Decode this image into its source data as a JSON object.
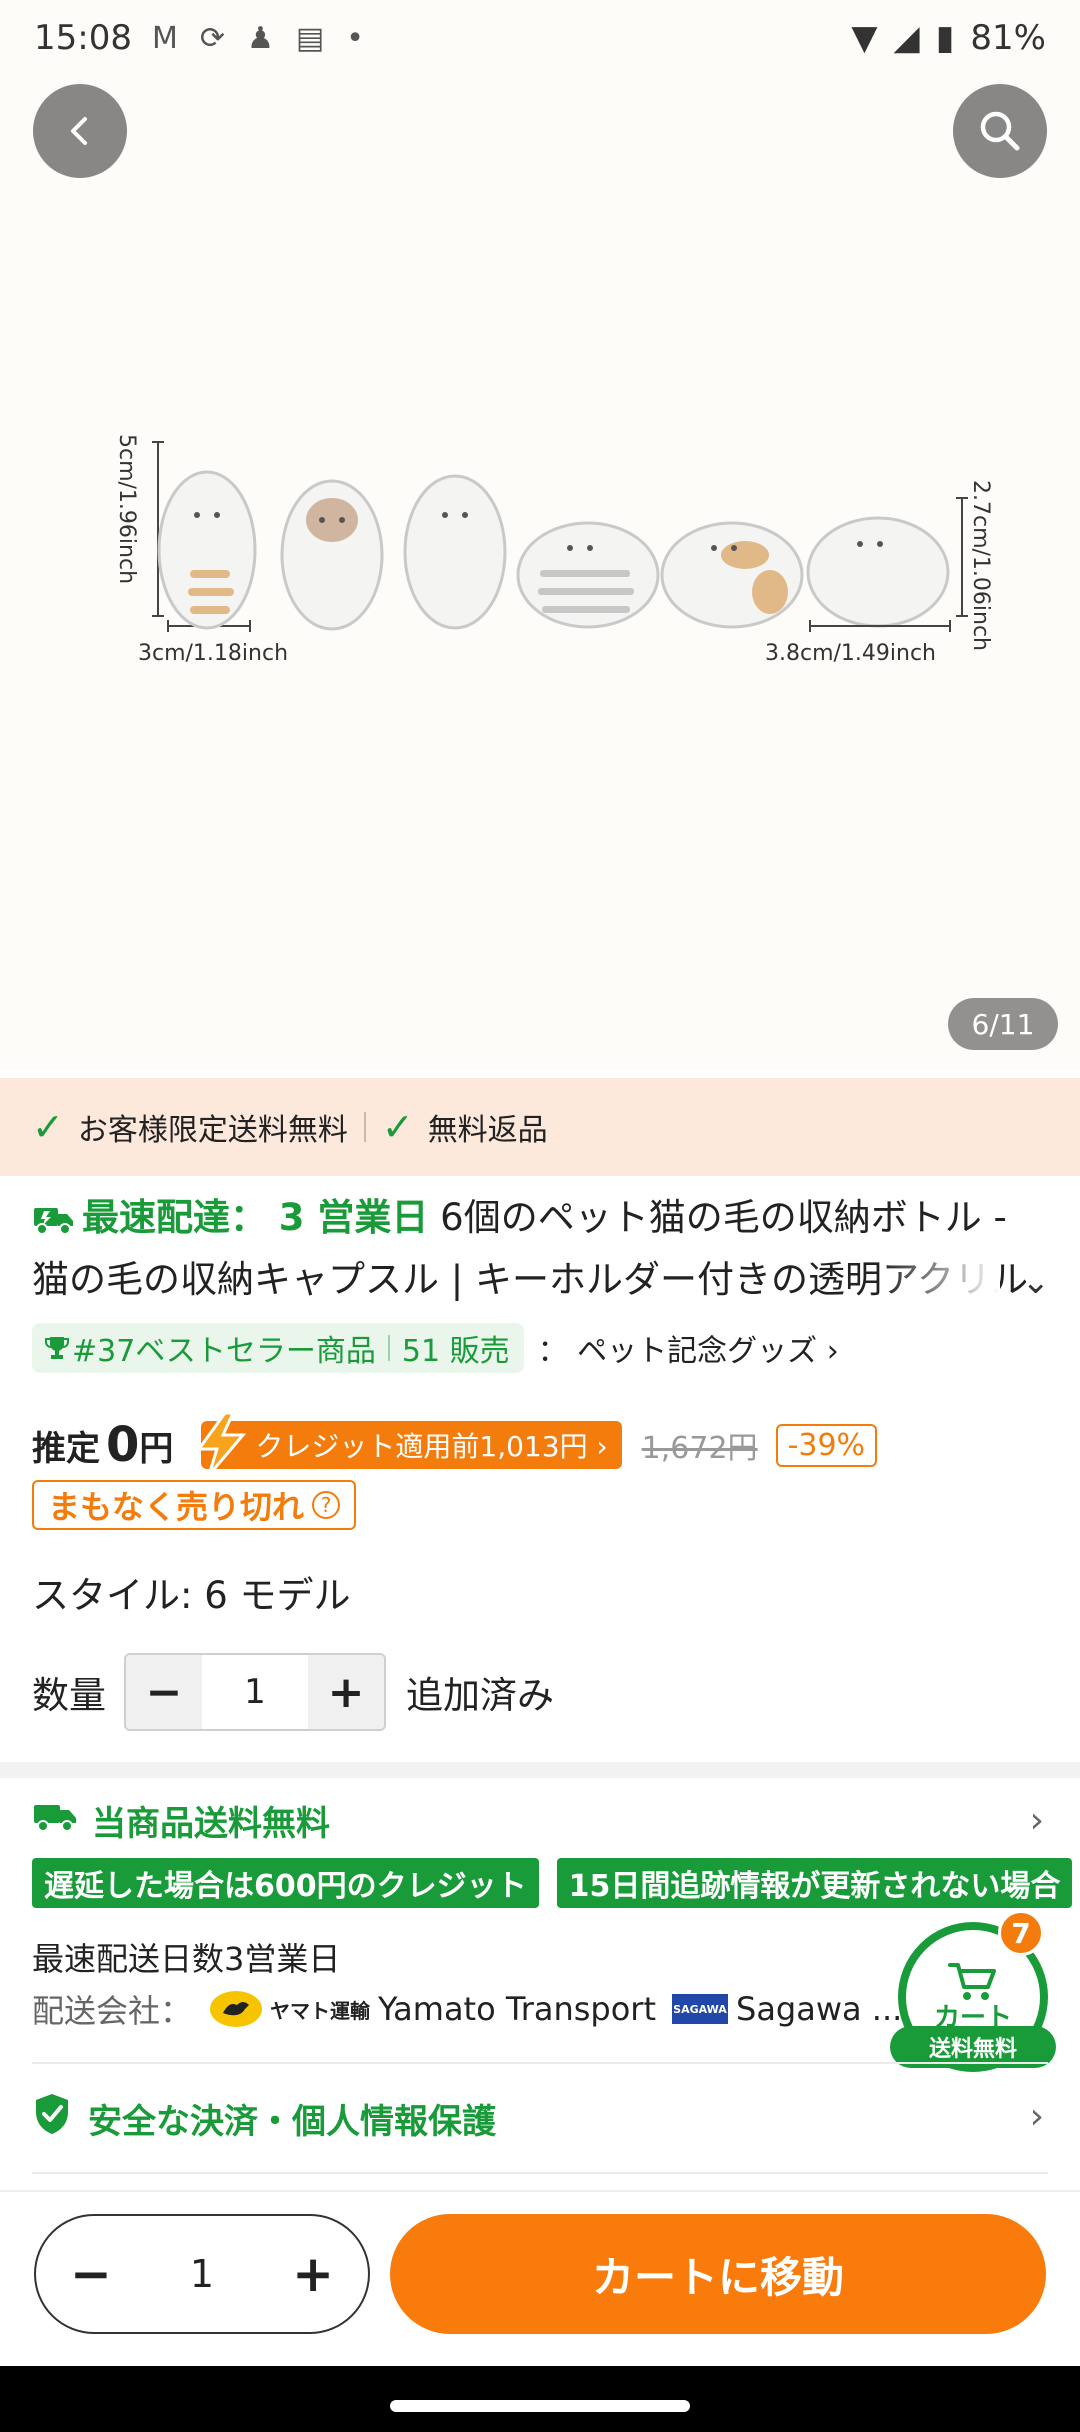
{
  "status_bar": {
    "time": "15:08",
    "battery": "81%",
    "icons": [
      "gmail-icon",
      "sync-icon",
      "keyhole-icon",
      "calendar-icon",
      "dot-icon"
    ]
  },
  "gallery": {
    "page_indicator": "6/11",
    "product_labels": {
      "height_left": "5cm/1.96inch",
      "width_left": "3cm/1.18inch",
      "height_right": "2.7cm/1.06inch",
      "width_right": "3.8cm/1.49inch"
    }
  },
  "promo": {
    "item1": "お客様限定送料無料",
    "item2": "無料返品"
  },
  "title": {
    "fast_label": "最速配達：",
    "fast_days": "3 営業日",
    "text": "6個のペット猫の毛の収納ボトル - 猫の毛の収納キャプスル | キーホルダー付きの透明アクリル"
  },
  "ranking": {
    "badge": "#37ベストセラー商品",
    "sold": "51 販売",
    "category": "： ペット記念グッズ ›"
  },
  "price": {
    "label": "推定",
    "value": "0",
    "yen": "円",
    "credit": "クレジット適用前1,013円 ›",
    "old_price": "1,672円",
    "discount": "-39%",
    "soldout": "まもなく売り切れ",
    "soldout_help": "?"
  },
  "style": {
    "text": "スタイル: 6 モデル"
  },
  "quantity": {
    "label": "数量",
    "minus": "−",
    "value": "1",
    "plus": "+",
    "added": "追加済み"
  },
  "shipping": {
    "title": "当商品送料無料",
    "tag1": "遅延した場合は600円のクレジット",
    "tag2": "15日間追跡情報が更新されない場合",
    "days": "最速配送日数3営業日",
    "carrier_label": "配送会社：",
    "yamato_jp": "ヤマト運輸",
    "carrier1": "Yamato Transport",
    "sagawa_logo": "SAGAWA",
    "carrier2": "Sagawa ..."
  },
  "cart_float": {
    "label": "カート",
    "badge": "7",
    "free": "送料無料"
  },
  "secure": {
    "text": "安全な決済・個人情報保護"
  },
  "bottom": {
    "minus": "−",
    "value": "1",
    "plus": "+",
    "cart_button": "カートに移動"
  },
  "colors": {
    "green": "#1a9b3a",
    "orange": "#f47c0d",
    "promo_bg": "#fde9dc"
  }
}
